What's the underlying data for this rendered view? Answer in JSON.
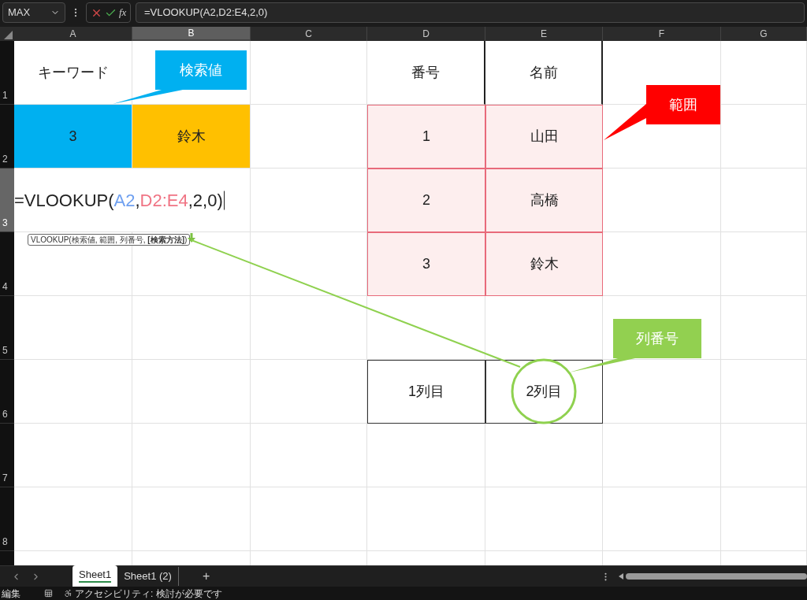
{
  "formula_bar": {
    "name_box": "MAX",
    "function_label": "fx",
    "formula": "=VLOOKUP(A2,D2:E4,2,0)"
  },
  "columns": [
    {
      "label": "A",
      "selected": false
    },
    {
      "label": "B",
      "selected": true
    },
    {
      "label": "C",
      "selected": false
    },
    {
      "label": "D",
      "selected": false
    },
    {
      "label": "E",
      "selected": false
    },
    {
      "label": "F",
      "selected": false
    },
    {
      "label": "G",
      "selected": false
    }
  ],
  "rows": [
    {
      "header": "1",
      "selected": false,
      "cells": [
        {
          "kind": "text",
          "text": "キーワード"
        },
        {
          "kind": "text"
        },
        {
          "kind": "text"
        },
        {
          "kind": "header",
          "text": "番号"
        },
        {
          "kind": "header",
          "text": "名前"
        },
        {
          "kind": "text"
        },
        {
          "kind": "text"
        }
      ]
    },
    {
      "header": "2",
      "selected": false,
      "cells": [
        {
          "kind": "text",
          "text": "3",
          "color": "#00b0f0"
        },
        {
          "kind": "text",
          "text": "鈴木",
          "color": "#ffc000"
        },
        {
          "kind": "text"
        },
        {
          "kind": "range",
          "text": "1",
          "color": "#fdeeee"
        },
        {
          "kind": "range",
          "text": "山田",
          "color": "#fdeeee"
        },
        {
          "kind": "text"
        },
        {
          "kind": "text"
        }
      ]
    },
    {
      "header": "3",
      "selected": true,
      "cells": [
        {
          "kind": "formula",
          "parts": [
            {
              "text": "=VLOOKUP("
            },
            {
              "text": "A2",
              "color": "#6fa0f0"
            },
            {
              "text": ","
            },
            {
              "text": "D2:E4",
              "color": "#f07484"
            },
            {
              "text": ",2,0)"
            }
          ]
        },
        {
          "kind": "text"
        },
        {
          "kind": "range",
          "text": "2",
          "color": "#fdeeee"
        },
        {
          "kind": "range",
          "text": "高橋",
          "color": "#fdeeee"
        },
        {
          "kind": "text"
        },
        {
          "kind": "text"
        }
      ]
    },
    {
      "header": "4",
      "selected": false,
      "cells": [
        {
          "kind": "text"
        },
        {
          "kind": "text"
        },
        {
          "kind": "text"
        },
        {
          "kind": "range",
          "text": "3",
          "color": "#fdeeee"
        },
        {
          "kind": "range",
          "text": "鈴木",
          "color": "#fdeeee"
        },
        {
          "kind": "text"
        },
        {
          "kind": "text"
        }
      ]
    },
    {
      "header": "5",
      "selected": false,
      "cells": [
        {
          "kind": "text"
        },
        {
          "kind": "text"
        },
        {
          "kind": "text"
        },
        {
          "kind": "text"
        },
        {
          "kind": "text"
        },
        {
          "kind": "text"
        },
        {
          "kind": "text"
        }
      ]
    },
    {
      "header": "6",
      "selected": false,
      "cells": [
        {
          "kind": "text"
        },
        {
          "kind": "text"
        },
        {
          "kind": "text"
        },
        {
          "kind": "boxed",
          "text": "1列目"
        },
        {
          "kind": "boxed",
          "text": "2列目"
        },
        {
          "kind": "text"
        },
        {
          "kind": "text"
        }
      ]
    },
    {
      "header": "7",
      "selected": false,
      "cells": [
        {
          "kind": "text"
        },
        {
          "kind": "text"
        },
        {
          "kind": "text"
        },
        {
          "kind": "text"
        },
        {
          "kind": "text"
        },
        {
          "kind": "text"
        },
        {
          "kind": "text"
        }
      ]
    },
    {
      "header": "8",
      "selected": false,
      "cells": [
        {
          "kind": "text"
        },
        {
          "kind": "text"
        },
        {
          "kind": "text"
        },
        {
          "kind": "text"
        },
        {
          "kind": "text"
        },
        {
          "kind": "text"
        },
        {
          "kind": "text"
        }
      ]
    }
  ],
  "tooltip": "VLOOKUP(検索値, 範囲, 列番号, **[検索方法]**)",
  "callouts": [
    {
      "text": "検索値",
      "color": "#00b0f0"
    },
    {
      "text": "範囲",
      "color": "#ff0000"
    },
    {
      "text": "列番号",
      "color": "#92d050"
    }
  ],
  "sheet_tabs": [
    {
      "label": "Sheet1",
      "selected": true
    },
    {
      "label": "Sheet1 (2)",
      "selected": false
    }
  ],
  "add_sheet": "+",
  "status_bar": {
    "mode": "編集",
    "accessibility": "アクセシビリティ: 検討が必要です"
  }
}
